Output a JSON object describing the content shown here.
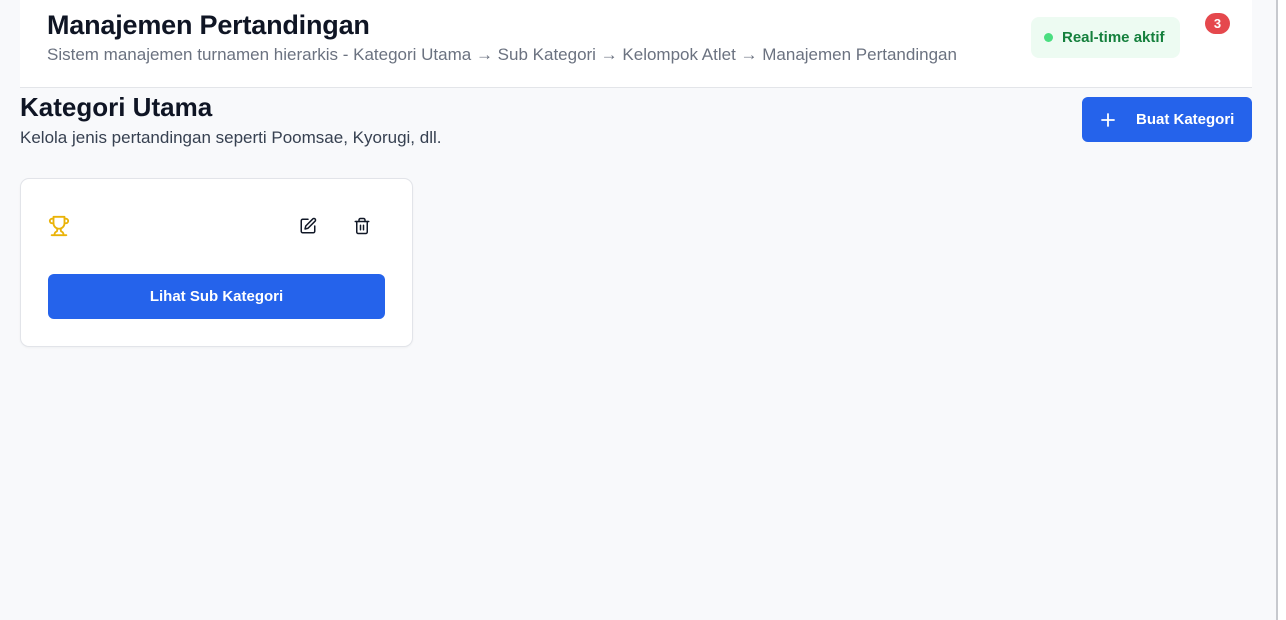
{
  "header": {
    "title": "Manajemen Pertandingan",
    "subtitle": "Sistem manajemen turnamen hierarkis - Kategori Utama → Sub Kategori → Kelompok Atlet → Manajemen Pertandingan",
    "realtime_label": "Real-time aktif",
    "notification_count": "3"
  },
  "section": {
    "title": "Kategori Utama",
    "description": "Kelola jenis pertandingan seperti Poomsae, Kyorugi, dll.",
    "create_button_label": "Buat Kategori"
  },
  "card": {
    "icon": "trophy-icon",
    "action_label": "Lihat Sub Kategori"
  },
  "colors": {
    "primary": "#2563eb",
    "trophy": "#eab308",
    "realtime_bg": "#edfbf2",
    "realtime_text": "#15803d",
    "badge": "#e5484d"
  }
}
